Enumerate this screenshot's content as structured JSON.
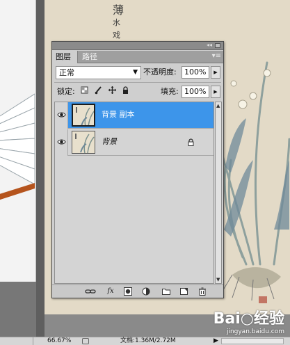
{
  "canvas_text": {
    "calligraphy": [
      "薄",
      "水",
      "戏"
    ]
  },
  "watermark": {
    "logo": "Bai○经验",
    "url": "jingyan.baidu.com"
  },
  "layers_panel": {
    "tabs": [
      {
        "label": "图层",
        "active": true
      },
      {
        "label": "路径",
        "active": false
      }
    ],
    "collapse_glyph": "◂◂",
    "menu_glyph": "▾≡",
    "blend_mode": "正常",
    "opacity_label": "不透明度:",
    "opacity_value": "100%",
    "lock_label": "锁定:",
    "fill_label": "填充:",
    "fill_value": "100%",
    "layers": [
      {
        "name": "背景 副本",
        "selected": true,
        "visible": true,
        "locked": false
      },
      {
        "name": "背景",
        "selected": false,
        "visible": true,
        "locked": true
      }
    ],
    "footer_icons": [
      "link-icon",
      "fx-icon",
      "mask-icon",
      "adjustment-icon",
      "folder-icon",
      "new-layer-icon",
      "trash-icon"
    ],
    "fx_label": "fx"
  },
  "status_bar": {
    "zoom": "66.67%",
    "doc_info": "文档:1.36M/2.72M",
    "arrow": "▶"
  },
  "colors": {
    "selection": "#3d95ea",
    "panel_bg": "#cfcfcf",
    "paper": "#e3dac7"
  }
}
